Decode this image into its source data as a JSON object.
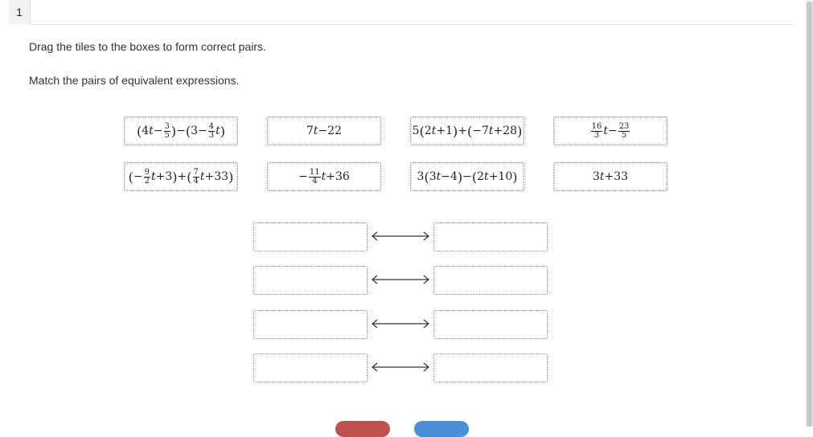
{
  "question": {
    "number": "1",
    "instruction_1": "Drag the tiles to the boxes to form correct pairs.",
    "instruction_2": "Match the pairs of equivalent expressions."
  },
  "tiles": [
    {
      "id": "tile-1",
      "expr": "(4t−3/5)−(3−4/3t)"
    },
    {
      "id": "tile-2",
      "expr": "7t−22"
    },
    {
      "id": "tile-3",
      "expr": "5(2t+1)+(−7t+28)"
    },
    {
      "id": "tile-4",
      "expr": "16/3t−23/5"
    },
    {
      "id": "tile-5",
      "expr": "(−9/2t+3)+(7/4t+33)"
    },
    {
      "id": "tile-6",
      "expr": "−11/4t+36"
    },
    {
      "id": "tile-7",
      "expr": "3(3t−4)−(2t+10)"
    },
    {
      "id": "tile-8",
      "expr": "3t+33"
    }
  ],
  "pair_rows": 4,
  "colors": {
    "tile_border": "#8a8a8a",
    "reset_button": "#c0504d",
    "next_button": "#4a90d9"
  }
}
